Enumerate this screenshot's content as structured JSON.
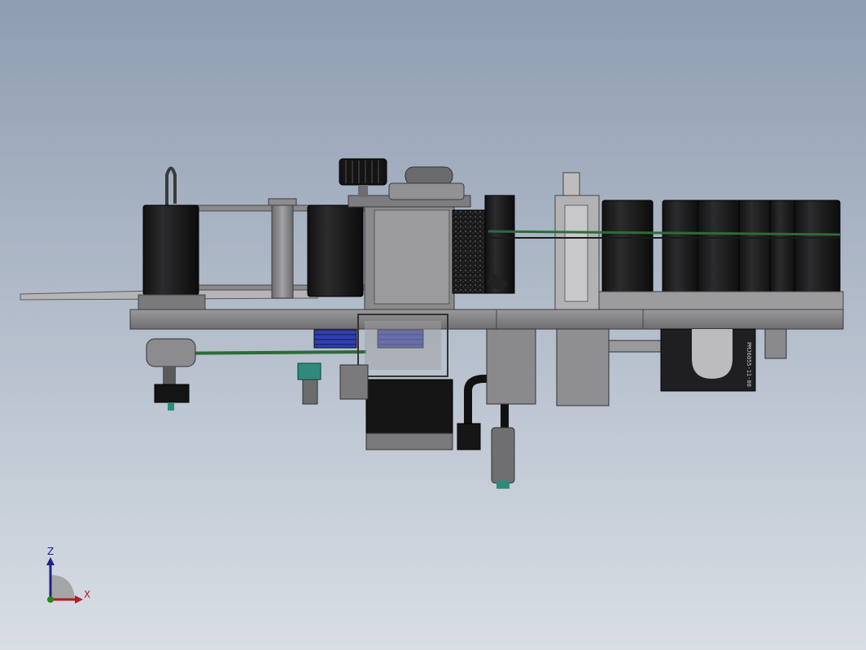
{
  "viewport": {
    "background_top": "#8e9db1",
    "background_bottom": "#d9dee5"
  },
  "model": {
    "name": "labeling machine assembly",
    "side_label": "PMJ6055-11-00",
    "colors": {
      "body_dark": "#1d1d1f",
      "frame_gray": "#7d7d80",
      "plate_light": "#a9a9ab",
      "belt_green": "#2f6a3a",
      "roller_blue": "#2f3fb5",
      "connector_teal": "#2f8a7c"
    }
  },
  "triad": {
    "z_label": "Z",
    "x_label": "X",
    "z_color": "#20208c",
    "x_color": "#b02020",
    "y_color": "#1f8a1f",
    "arc_color": "#9e9e9e"
  }
}
